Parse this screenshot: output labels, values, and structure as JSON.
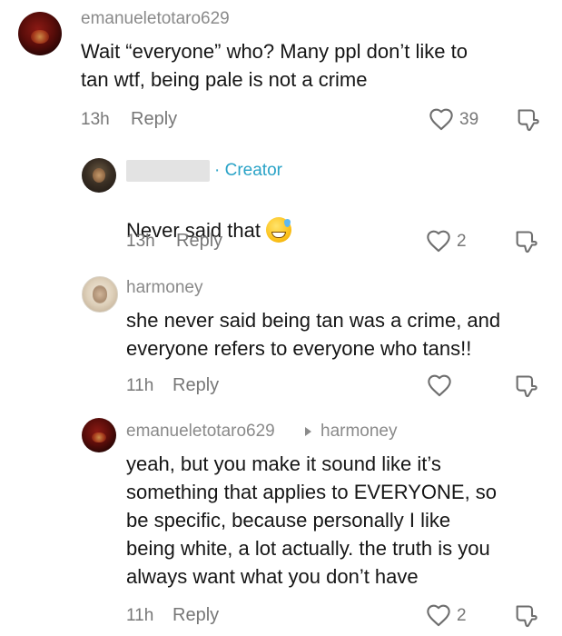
{
  "comments": [
    {
      "username": "emanueletotaro629",
      "text": "Wait “everyone” who? Many ppl don’t like to\ntan wtf, being pale is not a crime",
      "time": "13h",
      "reply_label": "Reply",
      "likes": "39"
    },
    {
      "username": "",
      "badge": "· Creator",
      "text": "Never said that",
      "emoji": "sweat-smile-emoji",
      "time": "13h",
      "reply_label": "Reply",
      "likes": "2"
    },
    {
      "username": "harmoney",
      "text": "she never said being tan was a crime, and\neveryone refers to everyone who tans!!",
      "time": "11h",
      "reply_label": "Reply",
      "likes": ""
    },
    {
      "username": "emanueletotaro629",
      "reply_to": "harmoney",
      "text": "yeah, but you make it sound like it’s\nsomething that applies to EVERYONE, so\nbe specific, because personally I like\nbeing white, a lot actually. the truth is you\nalways want what you don’t have",
      "time": "11h",
      "reply_label": "Reply",
      "likes": "2"
    }
  ],
  "icons": {
    "like": "heart-outline-icon",
    "dislike": "thumbs-down-outline-icon",
    "reply_to": "caret-right-icon"
  },
  "colors": {
    "creator_badge": "#2aa3c7",
    "text": "#161616",
    "meta": "#777777"
  }
}
